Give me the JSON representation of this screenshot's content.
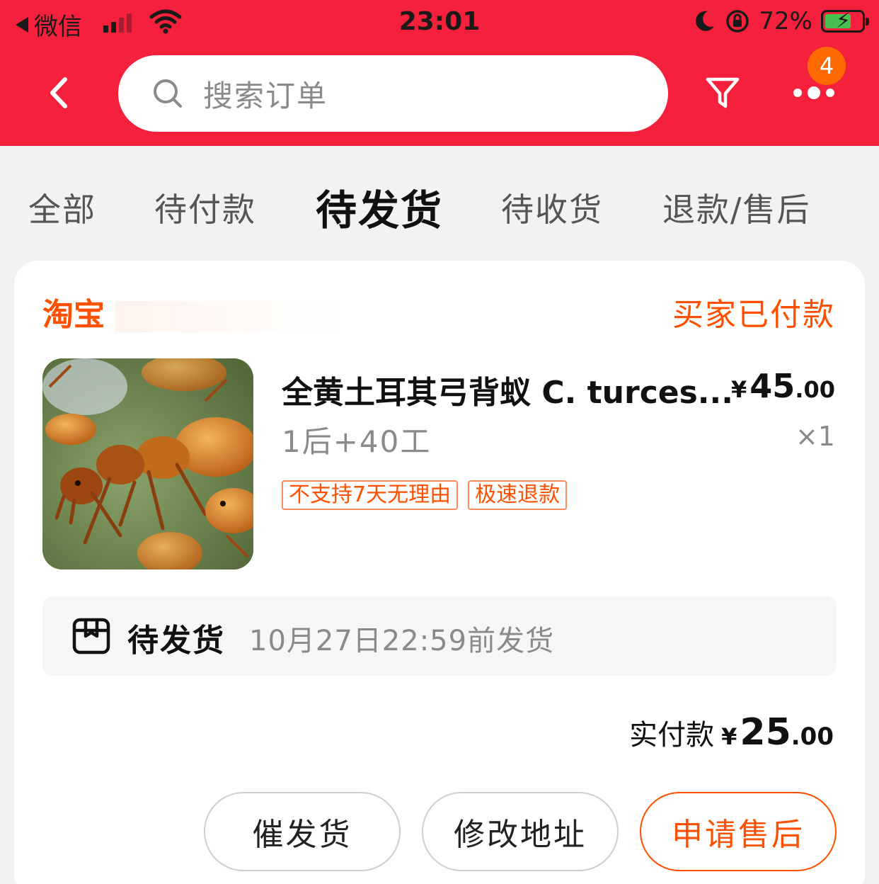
{
  "status_bar": {
    "back_app": "微信",
    "time": "23:01",
    "battery": "72%",
    "battery_level": 0.72
  },
  "nav": {
    "search_placeholder": "搜索订单",
    "more_badge": "4"
  },
  "tabs": [
    {
      "label": "全部"
    },
    {
      "label": "待付款"
    },
    {
      "label": "待发货",
      "active": true
    },
    {
      "label": "待收货"
    },
    {
      "label": "退款/售后"
    }
  ],
  "order": {
    "shop_name": "淘宝",
    "status": "买家已付款",
    "item": {
      "title": "全黄土耳其弓背蚁 C. turces...",
      "sku": "1后+40工",
      "price_currency": "¥",
      "price_int": "45",
      "price_dec": ".00",
      "quantity": "×1",
      "tags": [
        "不支持7天无理由",
        "极速退款"
      ]
    },
    "shipping": {
      "status": "待发货",
      "deadline": "10月27日22:59前发货"
    },
    "total": {
      "label": "实付款",
      "currency": "¥",
      "int": "25",
      "dec": ".00"
    },
    "actions": {
      "urge": "催发货",
      "change_address": "修改地址",
      "after_sales": "申请售后"
    }
  },
  "colors": {
    "header_red": "#f5213c",
    "accent_orange": "#ff5000",
    "badge_orange": "#ff6a00"
  }
}
